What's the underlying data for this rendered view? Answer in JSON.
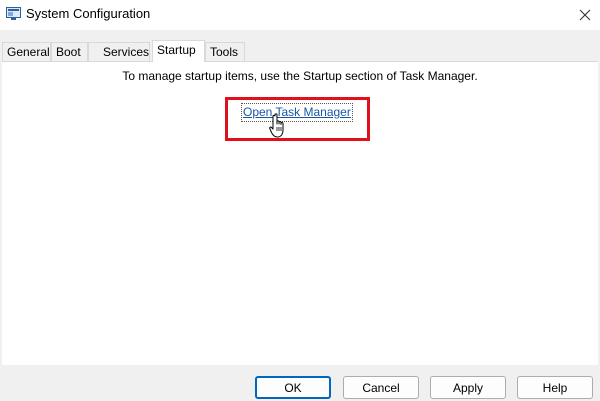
{
  "window": {
    "title": "System Configuration",
    "icon": "msconfig-app-icon",
    "close_glyph": "✕"
  },
  "tabs": [
    {
      "label": "General"
    },
    {
      "label": "Boot"
    },
    {
      "label": "Services"
    },
    {
      "label": "Startup",
      "selected": true
    },
    {
      "label": "Tools"
    }
  ],
  "startup_tab": {
    "message": "To manage startup items, use the Startup section of Task Manager.",
    "link_label": "Open Task Manager"
  },
  "buttons": {
    "ok": "OK",
    "cancel": "Cancel",
    "apply": "Apply",
    "help": "Help"
  },
  "colors": {
    "link": "#1a56a6",
    "highlight": "#e0101c",
    "default_button_border": "#0067c0"
  }
}
